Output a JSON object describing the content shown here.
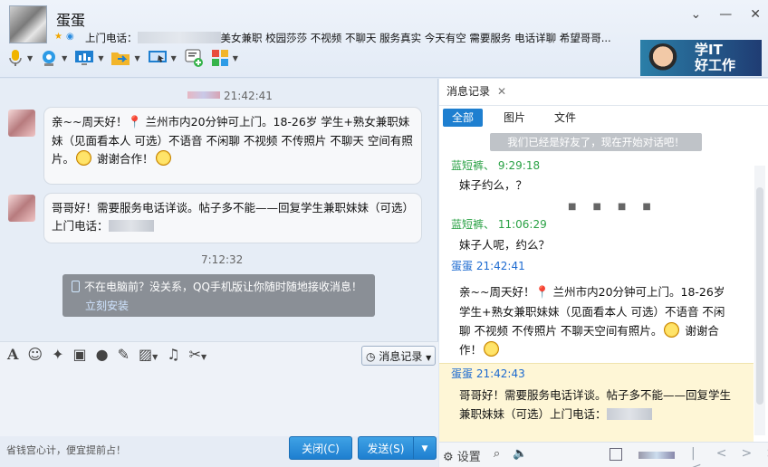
{
  "header": {
    "contact_name": "蛋蛋",
    "signature_prefix": "上门电话：",
    "signature_text": "美女兼职 校园莎莎 不视频 不聊天 服务真实  今天有空 需要服务 电话详聊 希望哥哥...",
    "window_buttons": [
      "⌄",
      "—",
      "✕"
    ],
    "toolbar": [
      "microphone-icon",
      "camera-icon",
      "screen-share-icon",
      "file-transfer-icon",
      "remote-desktop-icon",
      "sms-icon",
      "apps-icon"
    ],
    "banner_text_line1": "学IT",
    "banner_text_line2": "好工作"
  },
  "chat": {
    "time1": "21:42:41",
    "msg1": {
      "part1": "亲~~周天好！",
      "part2": " 兰州市内20分钟可上门。18-26岁  学生+熟女兼职妹妹（见面看本人 可选）不语音 不闲聊 不视频 不传照片 不聊天 空间有照片。",
      "part3": " 谢谢合作！"
    },
    "msg2": "哥哥好！需要服务电话详谈。帖子多不能——回复学生兼职妹妹（可选）上门电话：",
    "time2": "7:12:32",
    "promo_text": "不在电脑前？没关系，QQ手机版让你随时随地接收消息！",
    "promo_link": "立刻安装"
  },
  "input": {
    "history_button": "消息记录",
    "tip": "省钱宫心计，便宜提前占！",
    "close_button": "关闭(C)",
    "send_button": "发送(S)"
  },
  "history": {
    "tab_label": "消息记录",
    "filters": [
      "全部",
      "图片",
      "文件"
    ],
    "friend_note": "我们已经是好友了，现在开始对话吧！",
    "entries": [
      {
        "name": "蓝短裤、",
        "time": "9:29:18",
        "text": "妹子约么，？"
      },
      {
        "name": "蓝短裤、",
        "time": "11:06:29",
        "text": "妹子人呢，约么？"
      },
      {
        "name": "蛋蛋",
        "time": "21:42:41"
      },
      {
        "name": "蛋蛋",
        "time": "21:42:43"
      }
    ],
    "long_msg": {
      "part1": "亲~~周天好！",
      "part2": " 兰州市内20分钟可上门。18-26岁  学生+熟女兼职妹妹（见面看本人 可选）不语音 不闲聊 不视频 不传照片 不聊天空间有照片。",
      "part3": " 谢谢合作！"
    },
    "last_msg": "哥哥好！需要服务电话详谈。帖子多不能——回复学生兼职妹妹（可选）上门电话：",
    "settings_label": "设置"
  },
  "colors": {
    "accent": "#1e7fd0",
    "friend_name": "#2aa145",
    "self_name": "#1c6ad0",
    "highlight": "#fef6d6"
  }
}
